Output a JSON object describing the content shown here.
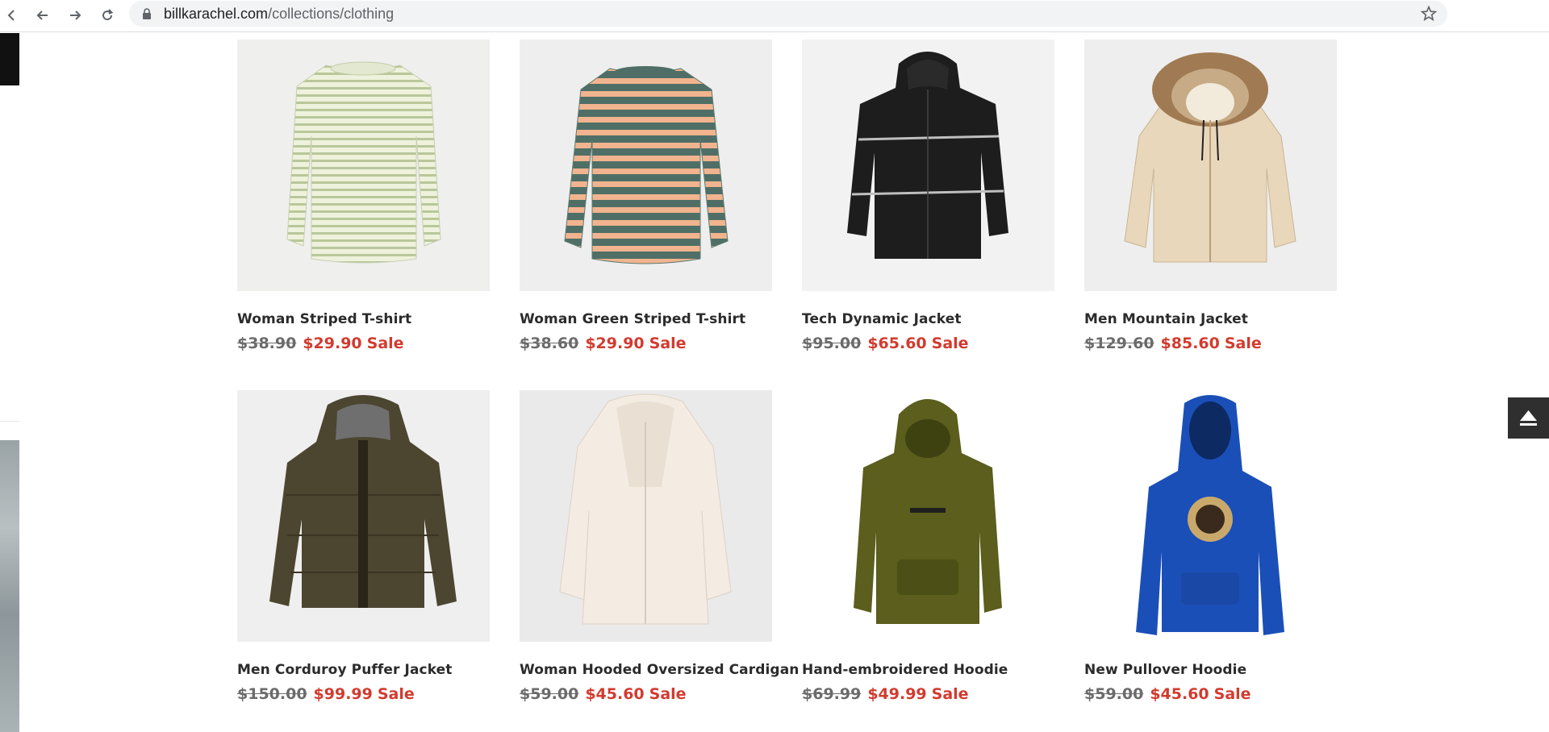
{
  "browser": {
    "url_domain": "billkarachel.com",
    "url_path": "/collections/clothing"
  },
  "products": [
    {
      "title": "Woman Striped T-shirt",
      "old_price": "$38.90",
      "new_price": "$29.90",
      "badge": "Sale",
      "image": "striped-longsleeve-light-green"
    },
    {
      "title": "Woman Green Striped T-shirt",
      "old_price": "$38.60",
      "new_price": "$29.90",
      "badge": "Sale",
      "image": "striped-longsleeve-teal-peach"
    },
    {
      "title": "Tech Dynamic Jacket",
      "old_price": "$95.00",
      "new_price": "$65.60",
      "badge": "Sale",
      "image": "black-hooded-jacket"
    },
    {
      "title": "Men Mountain Jacket",
      "old_price": "$129.60",
      "new_price": "$85.60",
      "badge": "Sale",
      "image": "beige-fur-hood-jacket"
    },
    {
      "title": "Men Corduroy Puffer Jacket",
      "old_price": "$150.00",
      "new_price": "$99.99",
      "badge": "Sale",
      "image": "olive-corduroy-puffer"
    },
    {
      "title": "Woman Hooded Oversized Cardigan",
      "old_price": "$59.00",
      "new_price": "$45.60",
      "badge": "Sale",
      "image": "cream-sherpa-cardigan"
    },
    {
      "title": "Hand-embroidered Hoodie",
      "old_price": "$69.99",
      "new_price": "$49.99",
      "badge": "Sale",
      "image": "olive-hoodie"
    },
    {
      "title": "New Pullover Hoodie",
      "old_price": "$59.00",
      "new_price": "$45.60",
      "badge": "Sale",
      "image": "royal-blue-hoodie"
    }
  ],
  "colors": {
    "sale_red": "#d23b2f",
    "old_price_gray": "#6b6b6b",
    "title_dark": "#2b2b2b"
  }
}
